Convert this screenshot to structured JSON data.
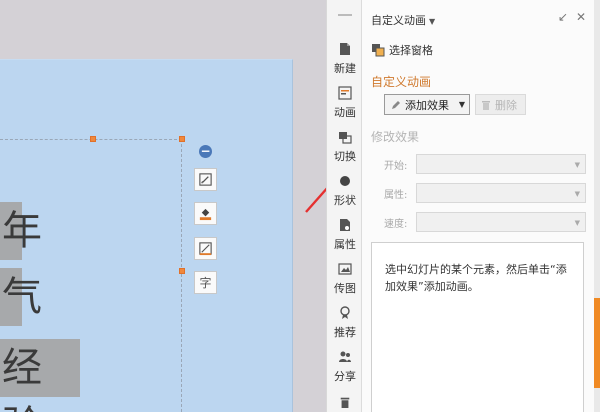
{
  "slide": {
    "text_lines": [
      "年",
      "气",
      "经验"
    ]
  },
  "float_toolbar": {
    "collapse_icon": "minus-circle-icon",
    "tools": [
      {
        "name": "edit-shape-icon"
      },
      {
        "name": "fill-color-icon"
      },
      {
        "name": "line-color-icon"
      },
      {
        "name": "text-wrap-icon",
        "glyph": "字"
      }
    ]
  },
  "sidebar": {
    "items": [
      {
        "label": "新建",
        "icon": "new-doc-icon"
      },
      {
        "label": "动画",
        "icon": "animation-icon"
      },
      {
        "label": "切换",
        "icon": "transition-icon"
      },
      {
        "label": "形状",
        "icon": "shape-icon"
      },
      {
        "label": "属性",
        "icon": "properties-icon"
      },
      {
        "label": "传图",
        "icon": "upload-image-icon"
      },
      {
        "label": "推荐",
        "icon": "recommend-icon"
      },
      {
        "label": "分享",
        "icon": "share-icon"
      },
      {
        "label": "",
        "icon": "trash-icon"
      }
    ]
  },
  "pane": {
    "title": "自定义动画",
    "select_pane_label": "选择窗格",
    "section_title": "自定义动画",
    "add_effect_label": "添加效果",
    "delete_label": "删除",
    "modify_title": "修改效果",
    "props": [
      {
        "label": "开始:",
        "value": ""
      },
      {
        "label": "属性:",
        "value": ""
      },
      {
        "label": "速度:",
        "value": ""
      }
    ],
    "hint": "选中幻灯片的某个元素，然后单击“添加效果”添加动画。"
  },
  "colors": {
    "accent_orange": "#d07a2e",
    "arrow_red": "#e53030",
    "slide_bg": "#bcd6f0"
  }
}
